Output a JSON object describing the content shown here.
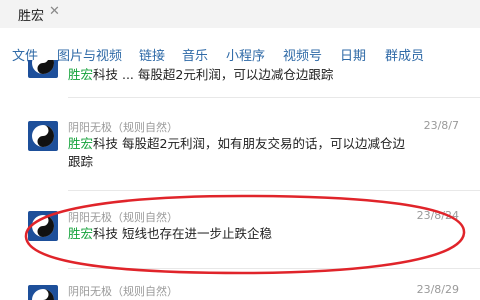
{
  "search": {
    "query": "胜宏"
  },
  "tabs": [
    {
      "label": "文件"
    },
    {
      "label": "图片与视频"
    },
    {
      "label": "链接"
    },
    {
      "label": "音乐"
    },
    {
      "label": "小程序"
    },
    {
      "label": "视频号"
    },
    {
      "label": "日期"
    },
    {
      "label": "群成员"
    }
  ],
  "messages": [
    {
      "highlight": "胜宏",
      "text": "科技 ... 每股超2元利润，可以边减仓边跟踪"
    },
    {
      "sender": "阴阳无极（规则自然）",
      "date": "23/8/7",
      "highlight": "胜宏",
      "text": "科技  每股超2元利润，如有朋友交易的话，可以边减仓边跟踪"
    },
    {
      "sender": "阴阳无极（规则自然）",
      "date": "23/8/24",
      "highlight": "胜宏",
      "text": "科技  短线也存在进一步止跌企稳"
    },
    {
      "sender": "阴阳无极（规则自然）",
      "date": "23/8/29"
    }
  ],
  "annotation_color": "#e0242a"
}
